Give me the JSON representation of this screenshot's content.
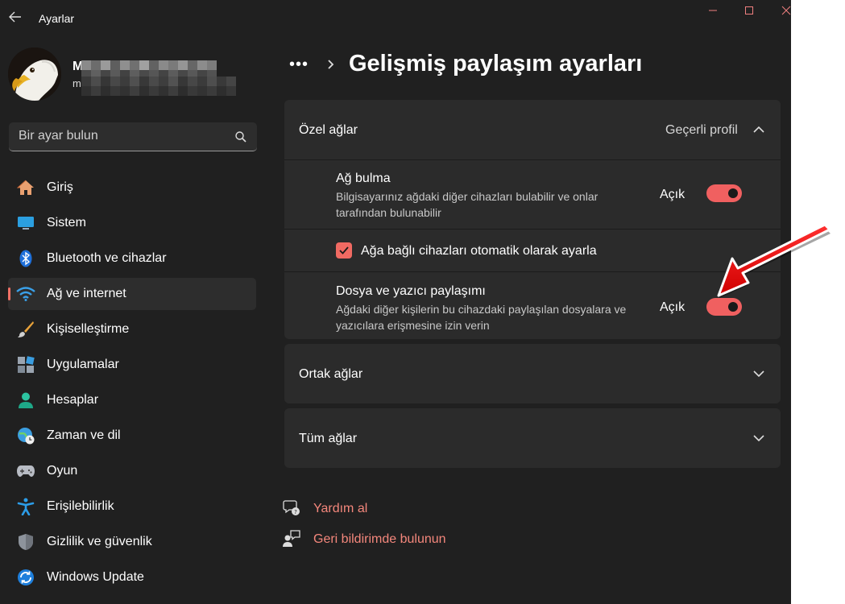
{
  "window": {
    "app_title": "Ayarlar"
  },
  "profile": {
    "name": "M",
    "email": "m"
  },
  "search": {
    "placeholder": "Bir ayar bulun"
  },
  "nav": {
    "items": [
      {
        "label": "Giriş",
        "icon": "home-icon"
      },
      {
        "label": "Sistem",
        "icon": "system-display-icon"
      },
      {
        "label": "Bluetooth ve cihazlar",
        "icon": "bluetooth-icon"
      },
      {
        "label": "Ağ ve internet",
        "icon": "wifi-icon",
        "selected": true
      },
      {
        "label": "Kişiselleştirme",
        "icon": "paintbrush-icon"
      },
      {
        "label": "Uygulamalar",
        "icon": "apps-icon"
      },
      {
        "label": "Hesaplar",
        "icon": "account-icon"
      },
      {
        "label": "Zaman ve dil",
        "icon": "globe-clock-icon"
      },
      {
        "label": "Oyun",
        "icon": "gamepad-icon"
      },
      {
        "label": "Erişilebilirlik",
        "icon": "accessibility-icon"
      },
      {
        "label": "Gizlilik ve güvenlik",
        "icon": "shield-icon"
      },
      {
        "label": "Windows Update",
        "icon": "update-icon"
      }
    ]
  },
  "breadcrumb": {
    "more": "•••",
    "title": "Gelişmiş paylaşım ayarları"
  },
  "private_networks": {
    "title": "Özel ağlar",
    "status": "Geçerli profil",
    "expanded": true,
    "network_discovery": {
      "title": "Ağ bulma",
      "description": "Bilgisayarınız ağdaki diğer cihazları bulabilir ve onlar tarafından bulunabilir",
      "state_label": "Açık",
      "on": true
    },
    "auto_setup": {
      "label": "Ağa bağlı cihazları otomatik olarak ayarla",
      "checked": true
    },
    "file_printer_sharing": {
      "title": "Dosya ve yazıcı paylaşımı",
      "description": "Ağdaki diğer kişilerin bu cihazdaki paylaşılan dosyalara ve yazıcılara erişmesine izin verin",
      "state_label": "Açık",
      "on": true
    }
  },
  "public_networks": {
    "title": "Ortak ağlar",
    "expanded": false
  },
  "all_networks": {
    "title": "Tüm ağlar",
    "expanded": false
  },
  "links": {
    "help": "Yardım al",
    "feedback": "Geri bildirimde bulunun"
  },
  "colors": {
    "window_bg": "#202020",
    "card_bg": "#2b2b2b",
    "accent": "#f06060",
    "link": "#f4877c",
    "annotation_arrow": "#e81010"
  }
}
